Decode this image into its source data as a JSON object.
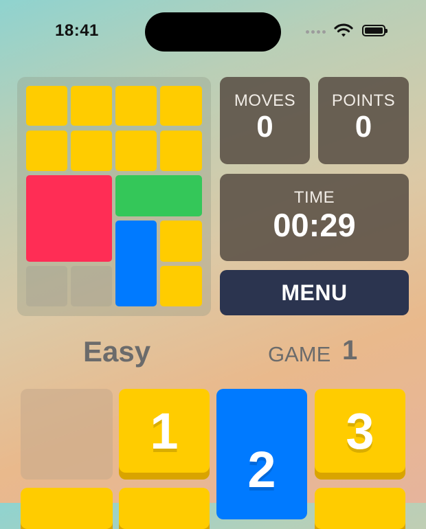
{
  "status_bar": {
    "time": "18:41"
  },
  "preview": {
    "tiles": [
      {
        "color": "yellow"
      },
      {
        "color": "yellow"
      },
      {
        "color": "yellow"
      },
      {
        "color": "yellow"
      },
      {
        "color": "yellow"
      },
      {
        "color": "yellow"
      },
      {
        "color": "yellow"
      },
      {
        "color": "yellow"
      },
      {
        "color": "red"
      },
      {
        "color": "green"
      },
      {
        "color": "blue"
      },
      {
        "color": "yellow"
      },
      {
        "color": "yellow"
      },
      {
        "color": "empty"
      },
      {
        "color": "empty"
      }
    ]
  },
  "stats": {
    "moves_label": "MOVES",
    "moves_value": "0",
    "points_label": "POINTS",
    "points_value": "0",
    "time_label": "TIME",
    "time_value": "00:29"
  },
  "menu": {
    "label": "MENU"
  },
  "game_info": {
    "difficulty": "Easy",
    "game_label": "GAME",
    "game_number": "1"
  },
  "board": {
    "tiles": [
      "1",
      "2",
      "3"
    ]
  },
  "colors": {
    "yellow": "#ffcc00",
    "red": "#ff2d55",
    "green": "#34c759",
    "blue": "#007aff",
    "dark_stat": "#5a5046",
    "menu_bg": "#2b344f"
  }
}
